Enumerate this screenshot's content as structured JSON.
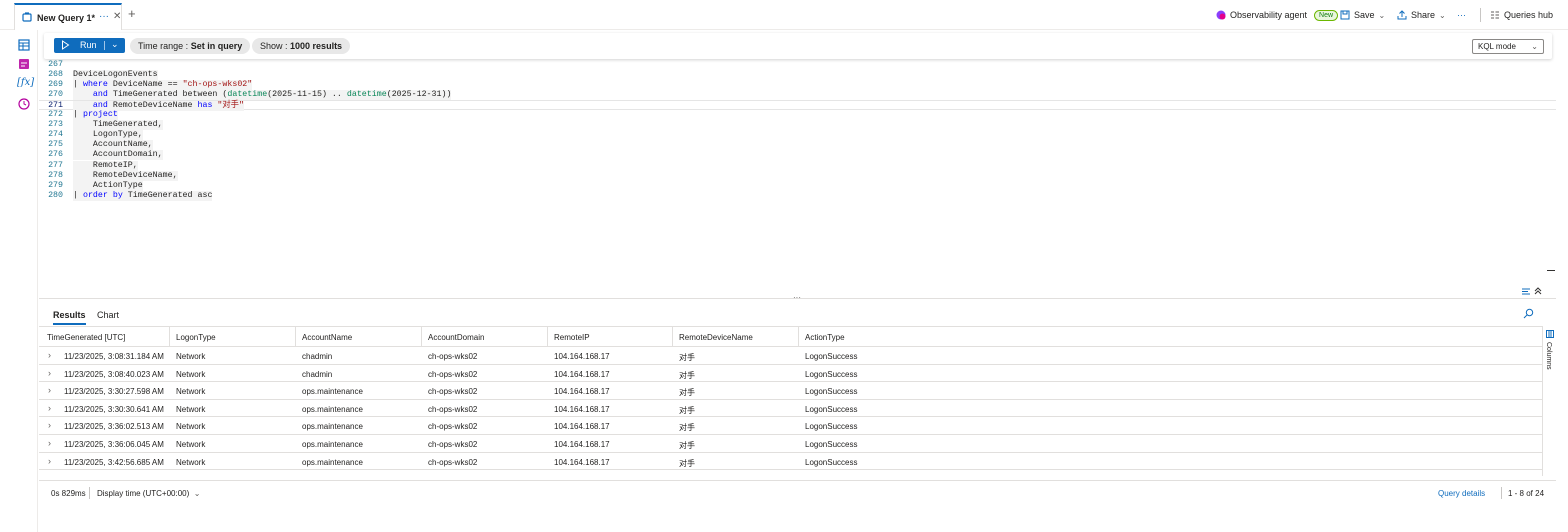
{
  "tab": {
    "title": "New Query 1*",
    "more": "···",
    "close": "✕",
    "add": "+"
  },
  "header": {
    "agent_label": "Observability agent",
    "agent_badge": "New",
    "save_label": "Save",
    "share_label": "Share",
    "more": "···",
    "queries_hub_label": "Queries hub"
  },
  "toolbar": {
    "run_label": "Run",
    "time_range_label": "Time range :",
    "time_range_value": "Set in query",
    "show_label": "Show :",
    "show_value": "1000 results",
    "mode_label": "KQL mode"
  },
  "editor": {
    "current_line": "271",
    "lines": [
      {
        "n": "267",
        "tokens": []
      },
      {
        "n": "268",
        "tokens": [
          [
            "ident",
            "DeviceLogonEvents"
          ]
        ]
      },
      {
        "n": "269",
        "tokens": [
          [
            "ident",
            "| "
          ],
          [
            "kw",
            "where"
          ],
          [
            "ident",
            " DeviceName == "
          ],
          [
            "str",
            "\"ch-ops-wks02\""
          ]
        ]
      },
      {
        "n": "270",
        "tokens": [
          [
            "ident",
            "    "
          ],
          [
            "kw",
            "and"
          ],
          [
            "ident",
            " TimeGenerated between ("
          ],
          [
            "fn",
            "datetime"
          ],
          [
            "ident",
            "(2025-11-15) .. "
          ],
          [
            "fn",
            "datetime"
          ],
          [
            "ident",
            "(2025-12-31))"
          ]
        ]
      },
      {
        "n": "271",
        "tokens": [
          [
            "ident",
            "    "
          ],
          [
            "kw",
            "and"
          ],
          [
            "ident",
            " RemoteDeviceName "
          ],
          [
            "kw",
            "has"
          ],
          [
            "ident",
            " "
          ],
          [
            "str",
            "\"对手\""
          ]
        ]
      },
      {
        "n": "272",
        "tokens": [
          [
            "ident",
            "| "
          ],
          [
            "kw",
            "project"
          ]
        ]
      },
      {
        "n": "273",
        "tokens": [
          [
            "ident",
            "    TimeGenerated,"
          ]
        ]
      },
      {
        "n": "274",
        "tokens": [
          [
            "ident",
            "    LogonType,"
          ]
        ]
      },
      {
        "n": "275",
        "tokens": [
          [
            "ident",
            "    AccountName,"
          ]
        ]
      },
      {
        "n": "276",
        "tokens": [
          [
            "ident",
            "    AccountDomain,"
          ]
        ]
      },
      {
        "n": "277",
        "tokens": [
          [
            "ident",
            "    RemoteIP,"
          ]
        ]
      },
      {
        "n": "278",
        "tokens": [
          [
            "ident",
            "    RemoteDeviceName,"
          ]
        ]
      },
      {
        "n": "279",
        "tokens": [
          [
            "ident",
            "    ActionType"
          ]
        ]
      },
      {
        "n": "280",
        "tokens": [
          [
            "ident",
            "| "
          ],
          [
            "kw",
            "order by"
          ],
          [
            "ident",
            " TimeGenerated asc"
          ]
        ]
      }
    ]
  },
  "results": {
    "tabs": [
      "Results",
      "Chart"
    ],
    "columns": [
      "TimeGenerated [UTC]",
      "LogonType",
      "AccountName",
      "AccountDomain",
      "RemoteIP",
      "RemoteDeviceName",
      "ActionType"
    ],
    "rows": [
      [
        "11/23/2025, 3:08:31.184 AM",
        "Network",
        "chadmin",
        "ch-ops-wks02",
        "104.164.168.17",
        "对手",
        "LogonSuccess"
      ],
      [
        "11/23/2025, 3:08:40.023 AM",
        "Network",
        "chadmin",
        "ch-ops-wks02",
        "104.164.168.17",
        "对手",
        "LogonSuccess"
      ],
      [
        "11/23/2025, 3:30:27.598 AM",
        "Network",
        "ops.maintenance",
        "ch-ops-wks02",
        "104.164.168.17",
        "对手",
        "LogonSuccess"
      ],
      [
        "11/23/2025, 3:30:30.641 AM",
        "Network",
        "ops.maintenance",
        "ch-ops-wks02",
        "104.164.168.17",
        "对手",
        "LogonSuccess"
      ],
      [
        "11/23/2025, 3:36:02.513 AM",
        "Network",
        "ops.maintenance",
        "ch-ops-wks02",
        "104.164.168.17",
        "对手",
        "LogonSuccess"
      ],
      [
        "11/23/2025, 3:36:06.045 AM",
        "Network",
        "ops.maintenance",
        "ch-ops-wks02",
        "104.164.168.17",
        "对手",
        "LogonSuccess"
      ],
      [
        "11/23/2025, 3:42:56.685 AM",
        "Network",
        "ops.maintenance",
        "ch-ops-wks02",
        "104.164.168.17",
        "对手",
        "LogonSuccess"
      ]
    ],
    "columns_panel_label": "Columns"
  },
  "status": {
    "duration": "0s 829ms",
    "display_time": "Display time (UTC+00:00)",
    "query_details": "Query details",
    "range": "1 - 8 of 24"
  },
  "colors": {
    "accent": "#0f6cbd",
    "keyword": "#0000ff",
    "string": "#a31515",
    "function": "#098658"
  }
}
